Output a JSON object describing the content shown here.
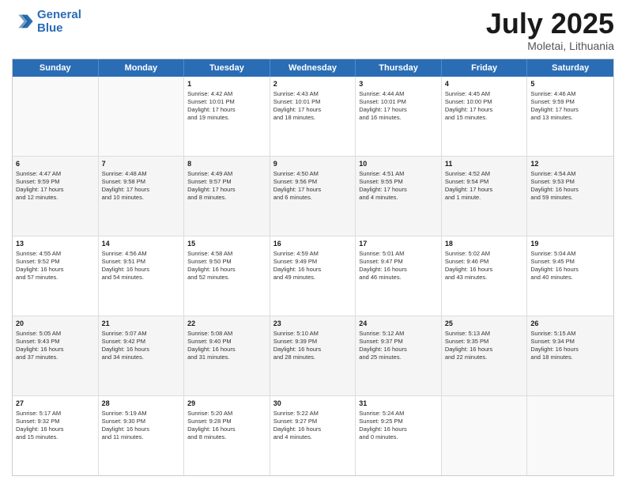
{
  "logo": {
    "line1": "General",
    "line2": "Blue"
  },
  "title": "July 2025",
  "location": "Moletai, Lithuania",
  "days_of_week": [
    "Sunday",
    "Monday",
    "Tuesday",
    "Wednesday",
    "Thursday",
    "Friday",
    "Saturday"
  ],
  "weeks": [
    [
      {
        "day": "",
        "info": ""
      },
      {
        "day": "",
        "info": ""
      },
      {
        "day": "1",
        "info": "Sunrise: 4:42 AM\nSunset: 10:01 PM\nDaylight: 17 hours\nand 19 minutes."
      },
      {
        "day": "2",
        "info": "Sunrise: 4:43 AM\nSunset: 10:01 PM\nDaylight: 17 hours\nand 18 minutes."
      },
      {
        "day": "3",
        "info": "Sunrise: 4:44 AM\nSunset: 10:01 PM\nDaylight: 17 hours\nand 16 minutes."
      },
      {
        "day": "4",
        "info": "Sunrise: 4:45 AM\nSunset: 10:00 PM\nDaylight: 17 hours\nand 15 minutes."
      },
      {
        "day": "5",
        "info": "Sunrise: 4:46 AM\nSunset: 9:59 PM\nDaylight: 17 hours\nand 13 minutes."
      }
    ],
    [
      {
        "day": "6",
        "info": "Sunrise: 4:47 AM\nSunset: 9:59 PM\nDaylight: 17 hours\nand 12 minutes."
      },
      {
        "day": "7",
        "info": "Sunrise: 4:48 AM\nSunset: 9:58 PM\nDaylight: 17 hours\nand 10 minutes."
      },
      {
        "day": "8",
        "info": "Sunrise: 4:49 AM\nSunset: 9:57 PM\nDaylight: 17 hours\nand 8 minutes."
      },
      {
        "day": "9",
        "info": "Sunrise: 4:50 AM\nSunset: 9:56 PM\nDaylight: 17 hours\nand 6 minutes."
      },
      {
        "day": "10",
        "info": "Sunrise: 4:51 AM\nSunset: 9:55 PM\nDaylight: 17 hours\nand 4 minutes."
      },
      {
        "day": "11",
        "info": "Sunrise: 4:52 AM\nSunset: 9:54 PM\nDaylight: 17 hours\nand 1 minute."
      },
      {
        "day": "12",
        "info": "Sunrise: 4:54 AM\nSunset: 9:53 PM\nDaylight: 16 hours\nand 59 minutes."
      }
    ],
    [
      {
        "day": "13",
        "info": "Sunrise: 4:55 AM\nSunset: 9:52 PM\nDaylight: 16 hours\nand 57 minutes."
      },
      {
        "day": "14",
        "info": "Sunrise: 4:56 AM\nSunset: 9:51 PM\nDaylight: 16 hours\nand 54 minutes."
      },
      {
        "day": "15",
        "info": "Sunrise: 4:58 AM\nSunset: 9:50 PM\nDaylight: 16 hours\nand 52 minutes."
      },
      {
        "day": "16",
        "info": "Sunrise: 4:59 AM\nSunset: 9:49 PM\nDaylight: 16 hours\nand 49 minutes."
      },
      {
        "day": "17",
        "info": "Sunrise: 5:01 AM\nSunset: 9:47 PM\nDaylight: 16 hours\nand 46 minutes."
      },
      {
        "day": "18",
        "info": "Sunrise: 5:02 AM\nSunset: 9:46 PM\nDaylight: 16 hours\nand 43 minutes."
      },
      {
        "day": "19",
        "info": "Sunrise: 5:04 AM\nSunset: 9:45 PM\nDaylight: 16 hours\nand 40 minutes."
      }
    ],
    [
      {
        "day": "20",
        "info": "Sunrise: 5:05 AM\nSunset: 9:43 PM\nDaylight: 16 hours\nand 37 minutes."
      },
      {
        "day": "21",
        "info": "Sunrise: 5:07 AM\nSunset: 9:42 PM\nDaylight: 16 hours\nand 34 minutes."
      },
      {
        "day": "22",
        "info": "Sunrise: 5:08 AM\nSunset: 9:40 PM\nDaylight: 16 hours\nand 31 minutes."
      },
      {
        "day": "23",
        "info": "Sunrise: 5:10 AM\nSunset: 9:39 PM\nDaylight: 16 hours\nand 28 minutes."
      },
      {
        "day": "24",
        "info": "Sunrise: 5:12 AM\nSunset: 9:37 PM\nDaylight: 16 hours\nand 25 minutes."
      },
      {
        "day": "25",
        "info": "Sunrise: 5:13 AM\nSunset: 9:35 PM\nDaylight: 16 hours\nand 22 minutes."
      },
      {
        "day": "26",
        "info": "Sunrise: 5:15 AM\nSunset: 9:34 PM\nDaylight: 16 hours\nand 18 minutes."
      }
    ],
    [
      {
        "day": "27",
        "info": "Sunrise: 5:17 AM\nSunset: 9:32 PM\nDaylight: 16 hours\nand 15 minutes."
      },
      {
        "day": "28",
        "info": "Sunrise: 5:19 AM\nSunset: 9:30 PM\nDaylight: 16 hours\nand 11 minutes."
      },
      {
        "day": "29",
        "info": "Sunrise: 5:20 AM\nSunset: 9:28 PM\nDaylight: 16 hours\nand 8 minutes."
      },
      {
        "day": "30",
        "info": "Sunrise: 5:22 AM\nSunset: 9:27 PM\nDaylight: 16 hours\nand 4 minutes."
      },
      {
        "day": "31",
        "info": "Sunrise: 5:24 AM\nSunset: 9:25 PM\nDaylight: 16 hours\nand 0 minutes."
      },
      {
        "day": "",
        "info": ""
      },
      {
        "day": "",
        "info": ""
      }
    ]
  ]
}
